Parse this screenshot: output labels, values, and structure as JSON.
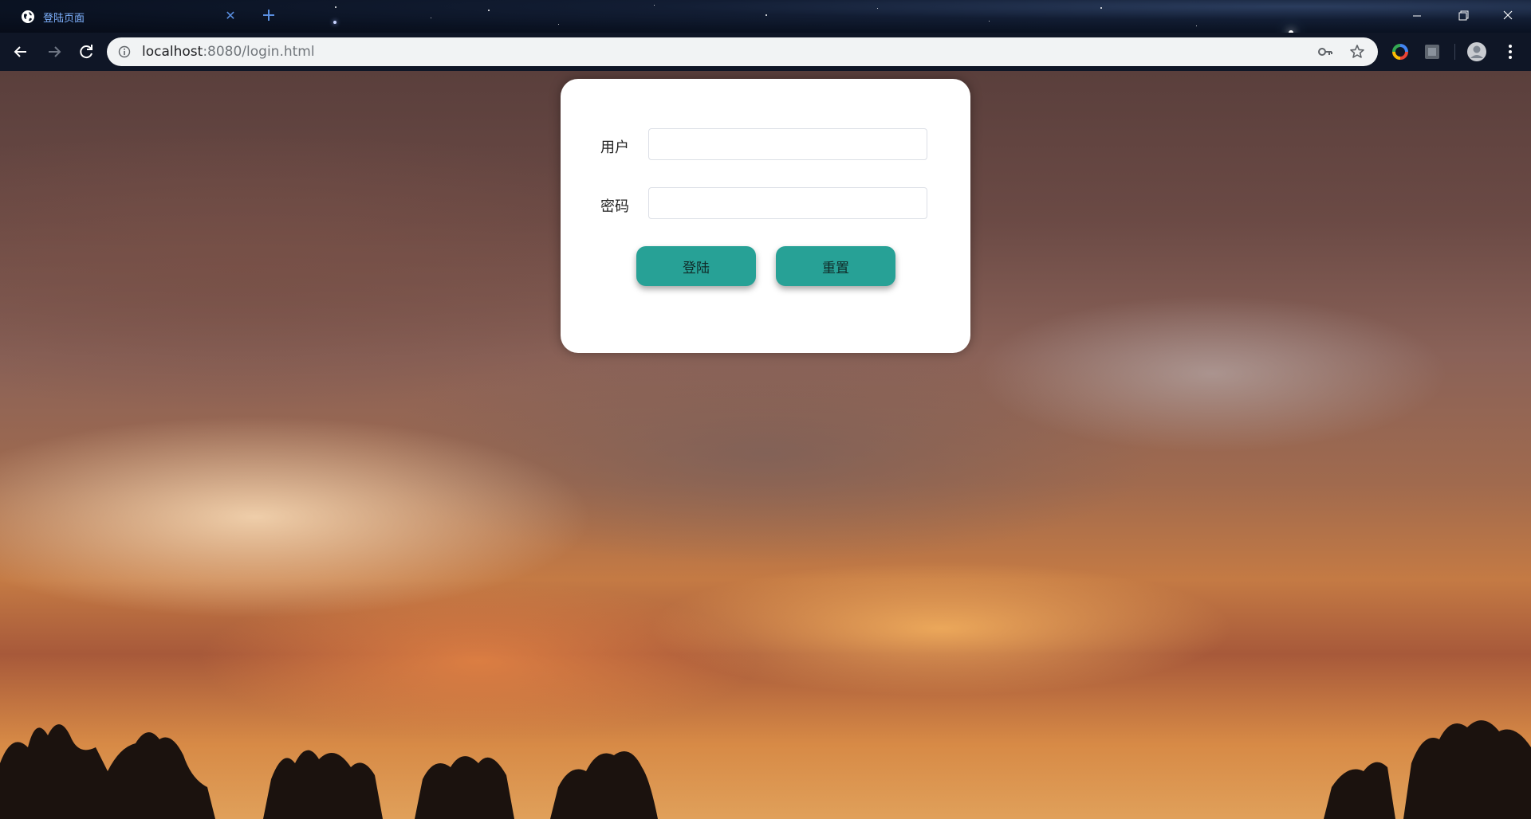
{
  "browser": {
    "tab": {
      "title": "登陆页面",
      "close_icon": "close-icon",
      "favicon": "globe-icon"
    },
    "new_tab_icon": "plus-icon",
    "window_controls": [
      "minimize-icon",
      "restore-icon",
      "close-icon"
    ],
    "nav": {
      "back_icon": "back-arrow-icon",
      "forward_icon": "forward-arrow-icon",
      "reload_icon": "reload-icon"
    },
    "address_bar": {
      "host": "localhost",
      "rest": ":8080/login.html",
      "site_info_icon": "info-icon",
      "password_icon": "key-icon",
      "bookmark_icon": "star-icon"
    },
    "extensions": [
      "color-wheel-icon",
      "extension-icon"
    ],
    "profile_icon": "avatar-icon",
    "menu_icon": "kebab-menu-icon"
  },
  "login": {
    "username_label": "用户",
    "username_value": "",
    "password_label": "密码",
    "password_value": "",
    "login_button": "登陆",
    "reset_button": "重置"
  },
  "colors": {
    "accent": "#27a196",
    "card": "#ffffff",
    "tab_text": "#7fb2ff"
  }
}
